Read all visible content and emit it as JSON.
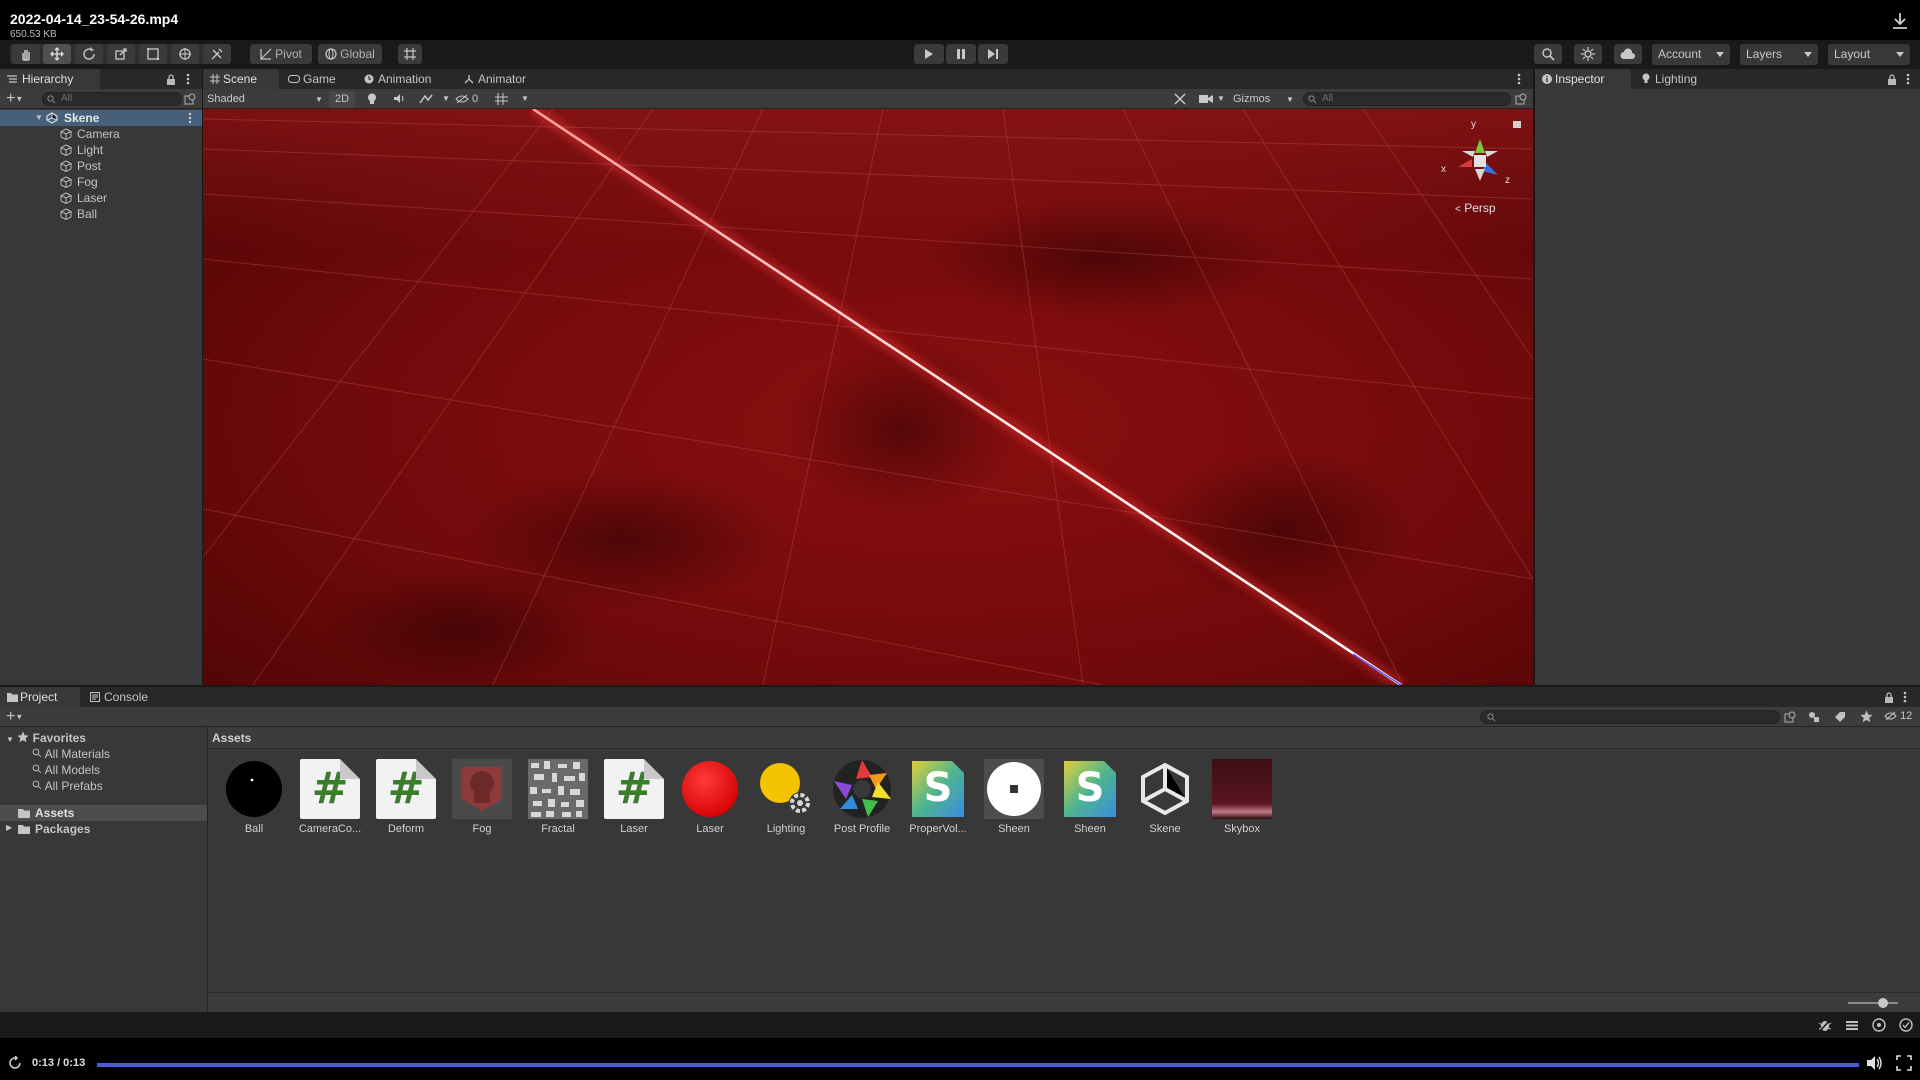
{
  "video": {
    "filename": "2022-04-14_23-54-26.mp4",
    "filesize": "650.53 KB",
    "time_display": "0:13 / 0:13",
    "progress": 1.0
  },
  "toolbar": {
    "pivot_label": "Pivot",
    "global_label": "Global",
    "account_label": "Account",
    "layers_label": "Layers",
    "layout_label": "Layout"
  },
  "hierarchy": {
    "tab_label": "Hierarchy",
    "search_placeholder": "All",
    "scene_name": "Skene",
    "items": [
      {
        "label": "Camera"
      },
      {
        "label": "Light"
      },
      {
        "label": "Post"
      },
      {
        "label": "Fog"
      },
      {
        "label": "Laser"
      },
      {
        "label": "Ball"
      }
    ]
  },
  "scene": {
    "tabs": [
      {
        "label": "Scene"
      },
      {
        "label": "Game"
      },
      {
        "label": "Animation"
      },
      {
        "label": "Animator"
      }
    ],
    "shading_mode": "Shaded",
    "mode_2d": "2D",
    "hidden_count": "0",
    "gizmos_label": "Gizmos",
    "search_placeholder": "All",
    "projection_label": "Persp",
    "axis_x": "x",
    "axis_y": "y",
    "axis_z": "z"
  },
  "inspector": {
    "tabs": [
      {
        "label": "Inspector"
      },
      {
        "label": "Lighting"
      }
    ]
  },
  "project": {
    "tabs": [
      {
        "label": "Project"
      },
      {
        "label": "Console"
      }
    ],
    "favorites_label": "Favorites",
    "favorites": [
      {
        "label": "All Materials"
      },
      {
        "label": "All Models"
      },
      {
        "label": "All Prefabs"
      }
    ],
    "assets_folder": "Assets",
    "packages_folder": "Packages",
    "breadcrumb": "Assets",
    "hidden_count": "12",
    "assets": [
      {
        "name": "Ball",
        "kind": "black-sphere"
      },
      {
        "name": "CameraCo...",
        "kind": "script"
      },
      {
        "name": "Deform",
        "kind": "script"
      },
      {
        "name": "Fog",
        "kind": "fog-material"
      },
      {
        "name": "Fractal",
        "kind": "noise-texture"
      },
      {
        "name": "Laser",
        "kind": "script"
      },
      {
        "name": "Laser",
        "kind": "red-sphere"
      },
      {
        "name": "Lighting",
        "kind": "lighting-settings"
      },
      {
        "name": "Post Profile",
        "kind": "post-profile"
      },
      {
        "name": "ProperVol...",
        "kind": "shader"
      },
      {
        "name": "Sheen",
        "kind": "white-sphere"
      },
      {
        "name": "Sheen",
        "kind": "shader"
      },
      {
        "name": "Skene",
        "kind": "unity-scene"
      },
      {
        "name": "Skybox",
        "kind": "skybox-material"
      }
    ]
  },
  "colors": {
    "scene_red": "#8a0d0d",
    "laser_core": "#ffe8e8",
    "script_green": "#3a7d2a",
    "progress_blue": "#4a5bd6"
  }
}
